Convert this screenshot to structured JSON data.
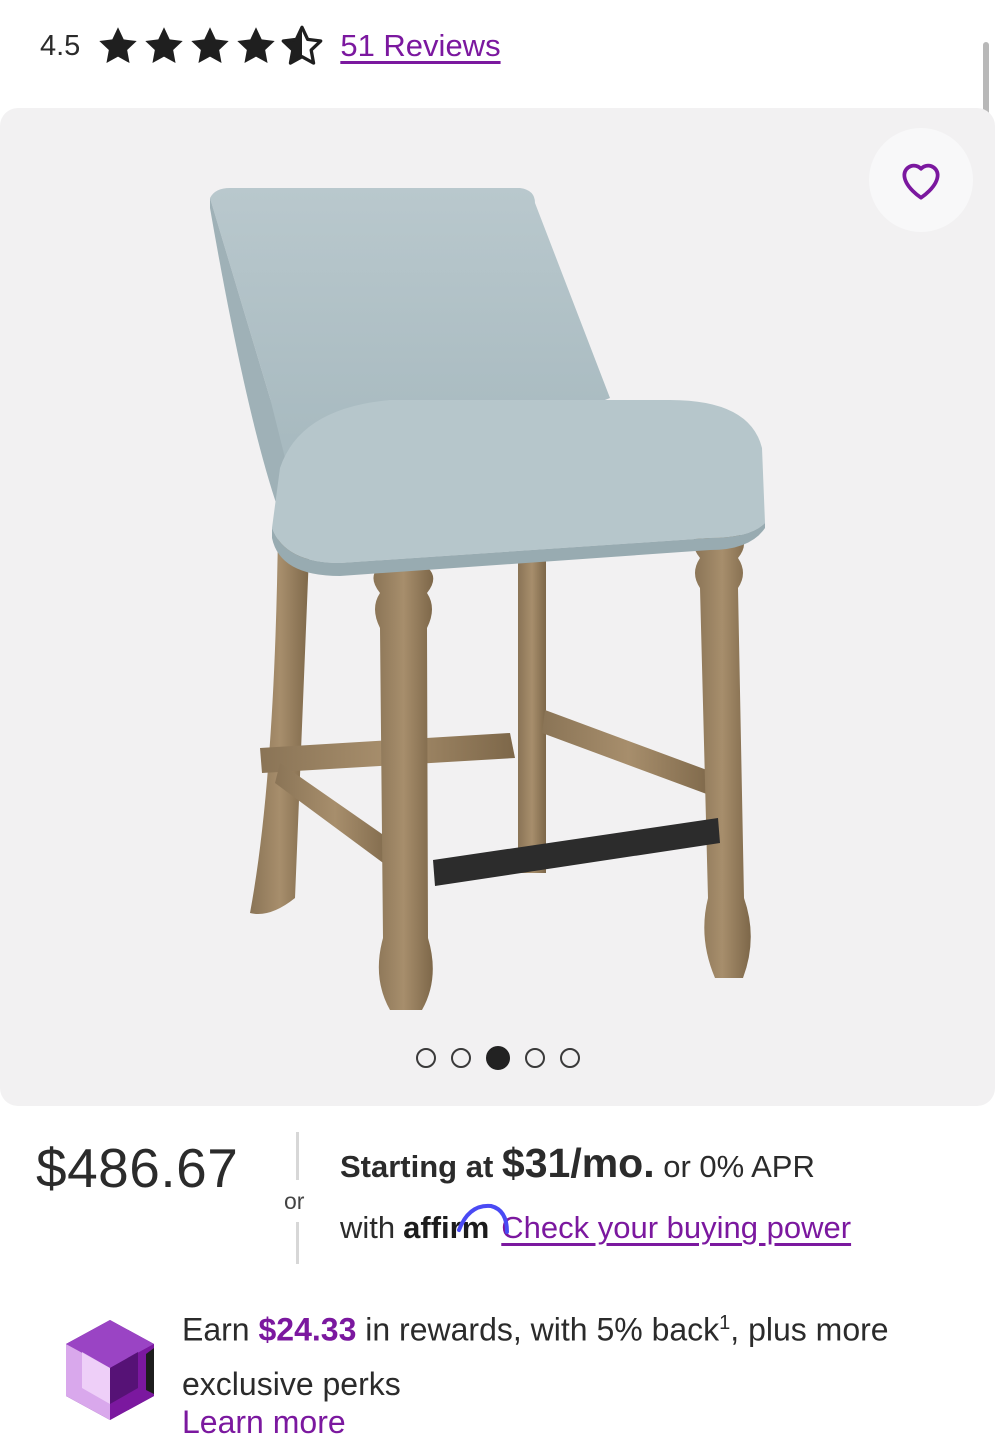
{
  "rating": {
    "value": "4.5",
    "stars": 4.5,
    "reviews_label": "51 Reviews"
  },
  "gallery": {
    "favorite_icon": "heart-outline-icon",
    "image_alt": "upholstered counter stool with light blue fabric and wooden legs",
    "slide_count": 5,
    "active_slide": 3
  },
  "pricing": {
    "price": "$486.67",
    "or_label": "or",
    "financing_prefix": "Starting at ",
    "financing_amount": "$31/mo.",
    "financing_suffix": " or 0% APR",
    "with_label": "with",
    "affirm_logo": "affirm",
    "buying_power_link": "Check your buying power"
  },
  "rewards": {
    "earn_prefix": "Earn ",
    "amount": "$24.33",
    "earn_suffix": " in rewards, with 5% back",
    "superscript": "1",
    "earn_tail": ", plus more exclusive perks",
    "learn_more": "Learn more",
    "gem_icon": "purple-gem-icon"
  },
  "colors": {
    "accent": "#7b189f",
    "gallery_bg": "#f2f1f2",
    "text": "#2b2b2b"
  }
}
